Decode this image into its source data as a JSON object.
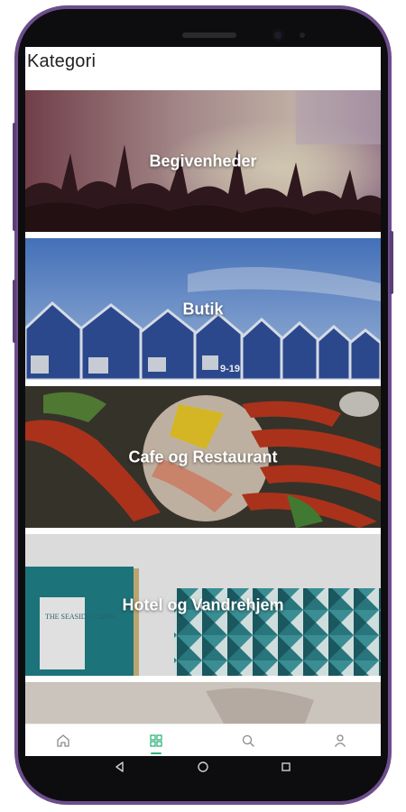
{
  "app": {
    "title": "Kategori"
  },
  "categories": [
    {
      "label": "Begivenheder",
      "image": "concert-crowd"
    },
    {
      "label": "Butik",
      "image": "blue-beach-huts"
    },
    {
      "label": "Cafe og Restaurant",
      "image": "crayfish-seafood-platter"
    },
    {
      "label": "Hotel og Vandrehjem",
      "image": "hotel-room-interior"
    },
    {
      "label": "",
      "image": "partial-card"
    }
  ],
  "hut_sign": "9-19",
  "hotel_sign": "THE SEASIDE CABIN",
  "bottom_nav": {
    "items": [
      {
        "icon": "home-icon",
        "active": false
      },
      {
        "icon": "grid-icon",
        "active": true
      },
      {
        "icon": "search-icon",
        "active": false
      },
      {
        "icon": "user-icon",
        "active": false
      }
    ]
  },
  "colors": {
    "accent": "#2fb37a",
    "phone_frame": "#6d4d8c",
    "nav_icon": "#8a8a8a"
  },
  "system_nav": [
    "back-icon",
    "home-circle-icon",
    "recents-icon"
  ]
}
